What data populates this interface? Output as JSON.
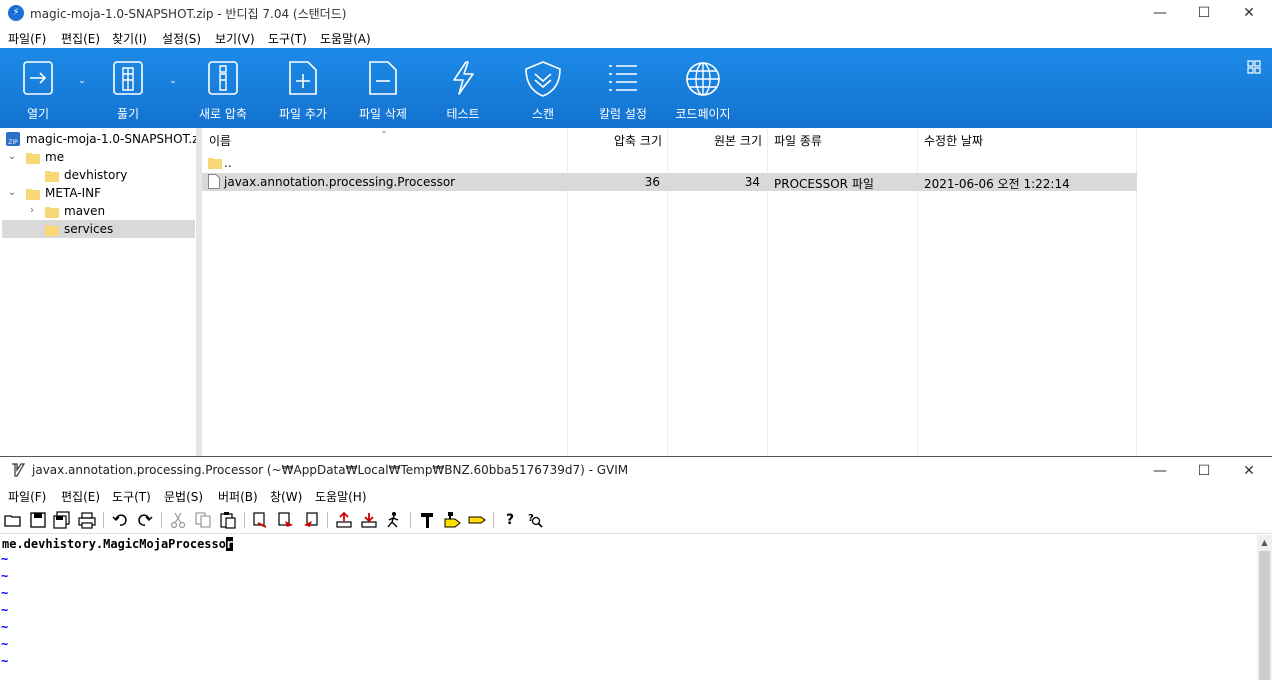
{
  "bandizip": {
    "title": "magic-moja-1.0-SNAPSHOT.zip - 반디집 7.04 (스탠더드)",
    "window_controls": {
      "minimize": "—",
      "maximize": "☐",
      "close": "✕"
    },
    "menu": [
      "파일(F)",
      "편집(E)",
      "찾기(I)",
      "설정(S)",
      "보기(V)",
      "도구(T)",
      "도움말(A)"
    ],
    "toolbar": [
      {
        "label": "열기",
        "icon": "open-archive-icon"
      },
      {
        "label": "풀기",
        "icon": "extract-icon"
      },
      {
        "label": "새로 압축",
        "icon": "new-archive-icon"
      },
      {
        "label": "파일 추가",
        "icon": "add-file-icon"
      },
      {
        "label": "파일 삭제",
        "icon": "delete-file-icon"
      },
      {
        "label": "테스트",
        "icon": "test-icon"
      },
      {
        "label": "스캔",
        "icon": "scan-shield-icon"
      },
      {
        "label": "칼럼 설정",
        "icon": "column-settings-icon"
      },
      {
        "label": "코드페이지",
        "icon": "codepage-globe-icon"
      }
    ],
    "toolbar_accent": "#1a7fe0",
    "tree": {
      "root": "magic-moja-1.0-SNAPSHOT.zip",
      "items": [
        {
          "label": "me",
          "level": 1,
          "expanded": true
        },
        {
          "label": "devhistory",
          "level": 2
        },
        {
          "label": "META-INF",
          "level": 1,
          "expanded": true
        },
        {
          "label": "maven",
          "level": 2,
          "collapsed": true
        },
        {
          "label": "services",
          "level": 2,
          "selected": true
        }
      ]
    },
    "columns": [
      "이름",
      "압축 크기",
      "원본 크기",
      "파일 종류",
      "수정한 날짜"
    ],
    "rows": [
      {
        "name": "..",
        "packed": "",
        "original": "",
        "type": "",
        "modified": ""
      },
      {
        "name": "javax.annotation.processing.Processor",
        "packed": "36",
        "original": "34",
        "type": "PROCESSOR 파일",
        "modified": "2021-06-06 오전 1:22:14"
      }
    ]
  },
  "gvim": {
    "title": "javax.annotation.processing.Processor (~₩AppData₩Local₩Temp₩BNZ.60bba5176739d7) - GVIM",
    "window_controls": {
      "minimize": "—",
      "maximize": "☐",
      "close": "✕"
    },
    "menu": [
      "파일(F)",
      "편집(E)",
      "도구(T)",
      "문법(S)",
      "버퍼(B)",
      "창(W)",
      "도움말(H)"
    ],
    "buffer_line": "me.devhistory.MagicMojaProcesso",
    "cursor_char": "r",
    "tilde": "~"
  }
}
